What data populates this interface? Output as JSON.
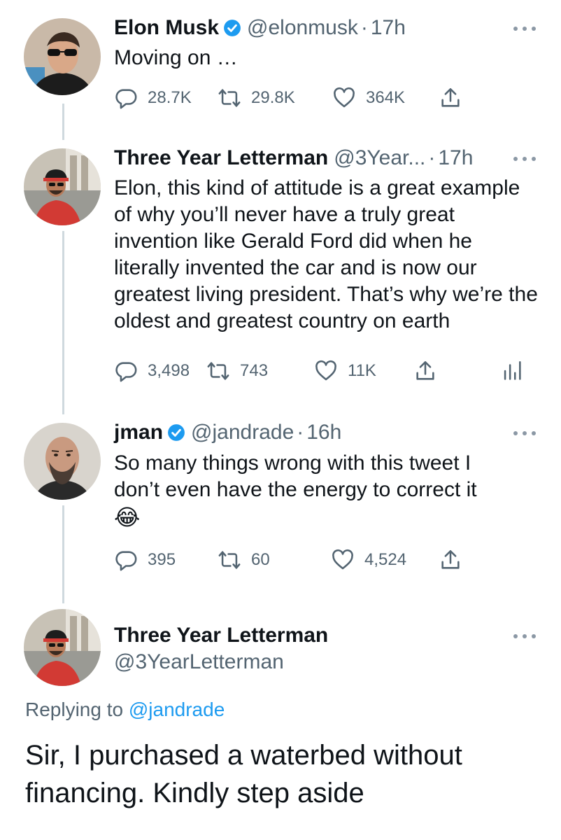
{
  "tweets": [
    {
      "name": "Elon Musk",
      "verified": true,
      "handle": "@elonmusk",
      "dot": "·",
      "time": "17h",
      "text": "Moving on …",
      "replies": "28.7K",
      "retweets": "29.8K",
      "likes": "364K"
    },
    {
      "name": "Three Year Letterman",
      "verified": false,
      "handle": "@3Year...",
      "dot": "·",
      "time": "17h",
      "text": "Elon, this kind of attitude is a great example of why you’ll never have a truly great invention like Gerald Ford did when he literally invented the car and is now our greatest living president. That’s why we’re the oldest and greatest country on earth",
      "replies": "3,498",
      "retweets": "743",
      "likes": "11K"
    },
    {
      "name": "jman",
      "verified": true,
      "handle": "@jandrade",
      "dot": "·",
      "time": "16h",
      "text": "So many things wrong with this tweet I don’t even have the energy to correct it",
      "emoji": "😂",
      "replies": "395",
      "retweets": "60",
      "likes": "4,524"
    }
  ],
  "main_tweet": {
    "name": "Three Year Letterman",
    "handle": "@3YearLetterman",
    "replying_prefix": "Replying to",
    "replying_to": "@jandrade",
    "text": "Sir, I purchased a waterbed without financing. Kindly step aside"
  },
  "colors": {
    "text": "#0f1419",
    "secondary": "#536471",
    "accent": "#1d9bf0",
    "thread_line": "#cfd9de"
  },
  "icons": {
    "reply": "reply-icon",
    "retweet": "retweet-icon",
    "like": "heart-icon",
    "share": "share-icon",
    "analytics": "analytics-icon",
    "verified": "verified-badge-icon",
    "more": "more-icon"
  }
}
